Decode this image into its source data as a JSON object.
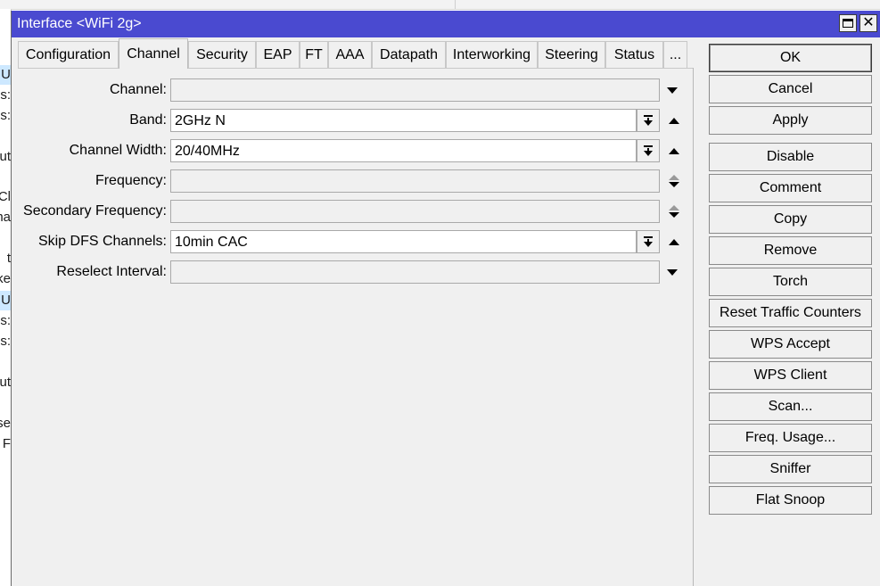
{
  "window": {
    "title": "Interface <WiFi 2g>"
  },
  "tabs": [
    {
      "label": "Configuration"
    },
    {
      "label": "Channel"
    },
    {
      "label": "Security"
    },
    {
      "label": "EAP"
    },
    {
      "label": "FT"
    },
    {
      "label": "AAA"
    },
    {
      "label": "Datapath"
    },
    {
      "label": "Interworking"
    },
    {
      "label": "Steering"
    },
    {
      "label": "Status"
    },
    {
      "label": "..."
    }
  ],
  "active_tab": "Channel",
  "fields": {
    "channel": {
      "label": "Channel:",
      "value": ""
    },
    "band": {
      "label": "Band:",
      "value": "2GHz N"
    },
    "channel_width": {
      "label": "Channel Width:",
      "value": "20/40MHz"
    },
    "frequency": {
      "label": "Frequency:",
      "value": ""
    },
    "secondary_frequency": {
      "label": "Secondary Frequency:",
      "value": ""
    },
    "skip_dfs_channels": {
      "label": "Skip DFS Channels:",
      "value": "10min CAC"
    },
    "reselect_interval": {
      "label": "Reselect Interval:",
      "value": ""
    }
  },
  "buttons": {
    "ok": "OK",
    "cancel": "Cancel",
    "apply": "Apply",
    "disable": "Disable",
    "comment": "Comment",
    "copy": "Copy",
    "remove": "Remove",
    "torch": "Torch",
    "reset_traffic_counters": "Reset Traffic Counters",
    "wps_accept": "WPS Accept",
    "wps_client": "WPS Client",
    "scan": "Scan...",
    "freq_usage": "Freq. Usage...",
    "sniffer": "Sniffer",
    "flat_snoop": "Flat Snoop"
  },
  "background_fragments": [
    "U",
    "s:",
    "s:",
    "ut",
    "Cl",
    "na",
    "t",
    "ke",
    "U",
    "s:",
    "s:",
    "ut",
    "se",
    "d F"
  ],
  "colors": {
    "titlebar": "#4a4ad0",
    "window_bg": "#f0f0f0",
    "selected_row_bg": "#cde8ff"
  }
}
